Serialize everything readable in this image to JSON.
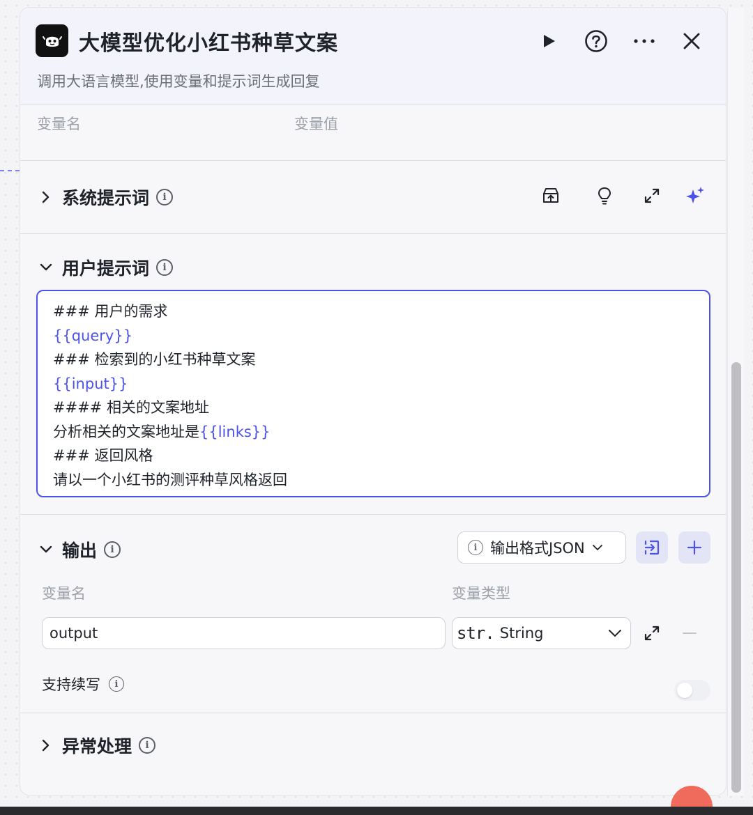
{
  "header": {
    "title": "大模型优化小红书种草文案",
    "subtitle": "调用大语言模型,使用变量和提示词生成回复",
    "icons": [
      "robot-icon",
      "play-icon",
      "help-icon",
      "more-icon",
      "close-icon"
    ]
  },
  "input_table": {
    "col_name": "变量名",
    "col_value": "变量值"
  },
  "system_prompt": {
    "title": "系统提示词",
    "tools": [
      "library-icon",
      "lightbulb-icon",
      "expand-icon",
      "sparkle-icon"
    ]
  },
  "user_prompt": {
    "title": "用户提示词",
    "lines": [
      {
        "pre": "### 用户的需求",
        "var": "",
        "post": ""
      },
      {
        "pre": "",
        "var": "{{query}}",
        "post": ""
      },
      {
        "pre": "### 检索到的小红书种草文案",
        "var": "",
        "post": ""
      },
      {
        "pre": "",
        "var": "{{input}}",
        "post": ""
      },
      {
        "pre": "#### 相关的文案地址",
        "var": "",
        "post": ""
      },
      {
        "pre": "分析相关的文案地址是",
        "var": "{{links}}",
        "post": ""
      },
      {
        "pre": "### 返回风格",
        "var": "",
        "post": ""
      },
      {
        "pre": "请以一个小红书的测评种草风格返回",
        "var": "",
        "post": ""
      }
    ]
  },
  "output": {
    "title": "输出",
    "format_label": "输出格式JSON",
    "col_name": "变量名",
    "col_type": "变量类型",
    "var_name": "output",
    "type_prefix": "str.",
    "type_value": "String",
    "continue_label": "支持续写",
    "continue_enabled": false
  },
  "exception": {
    "title": "异常处理"
  },
  "colors": {
    "accent": "#4d53e8",
    "header_bg": "#f2f3fb"
  }
}
